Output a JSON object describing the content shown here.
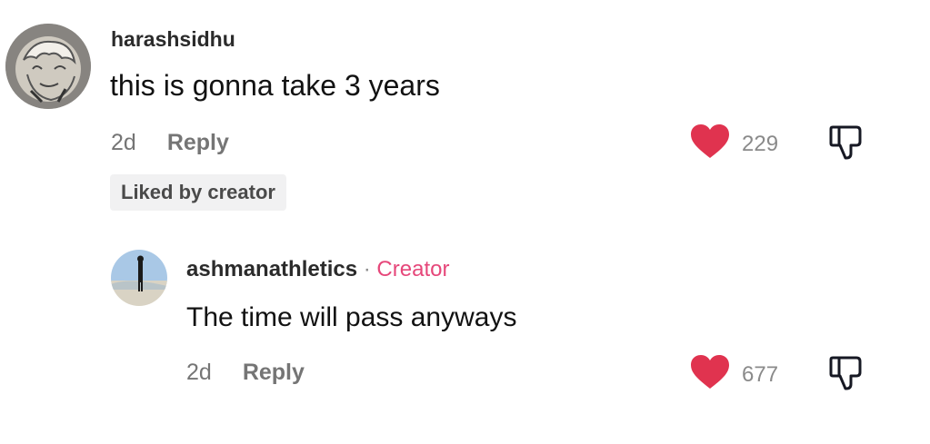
{
  "comment": {
    "username": "harashsidhu",
    "text": "this is gonna take 3 years",
    "time": "2d",
    "reply_label": "Reply",
    "badge": "Liked by creator",
    "like_count": "229",
    "heart_color": "#e0334f"
  },
  "reply": {
    "username": "ashmanathletics",
    "separator": "·",
    "role_tag": "Creator",
    "role_color": "#e6477a",
    "text": "The time will pass anyways",
    "time": "2d",
    "reply_label": "Reply",
    "like_count": "677",
    "heart_color": "#e0334f"
  }
}
